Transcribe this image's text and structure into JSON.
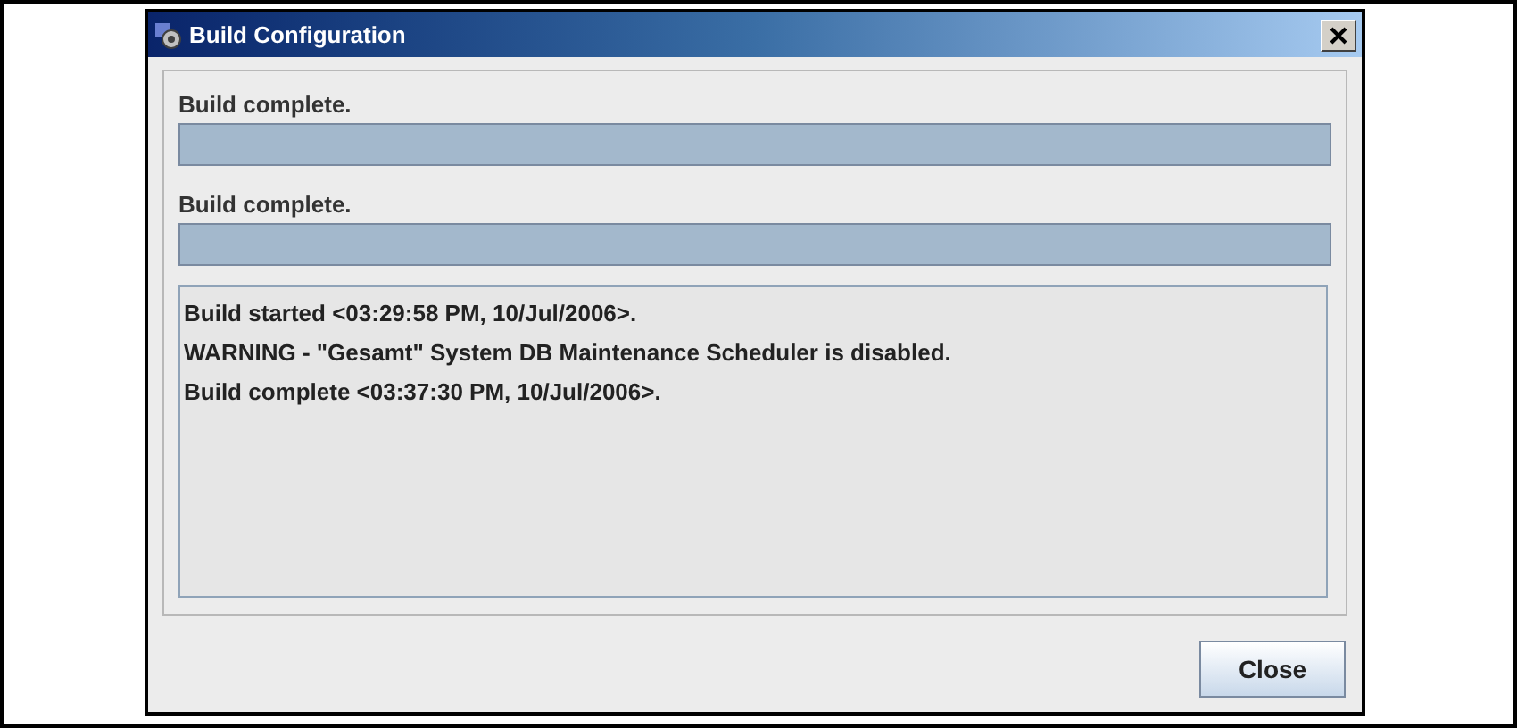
{
  "window": {
    "title": "Build Configuration"
  },
  "progress": [
    {
      "label": "Build complete.",
      "level": 1
    },
    {
      "label": "Build complete.",
      "level": 1
    }
  ],
  "log": [
    "Build started <03:29:58 PM, 10/Jul/2006>.",
    "WARNING - \"Gesamt\" System DB Maintenance Scheduler is disabled.",
    "Build complete <03:37:30 PM, 10/Jul/2006>."
  ],
  "buttons": [
    "Close"
  ]
}
